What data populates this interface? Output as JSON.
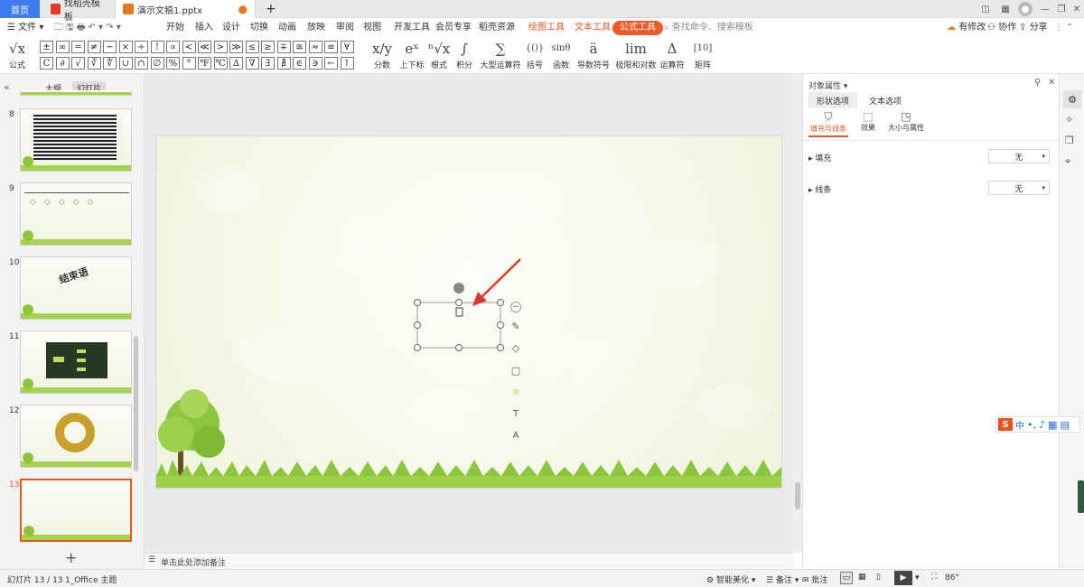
{
  "tabs": {
    "home": "首页",
    "template": "找稻壳模板",
    "document": "演示文稿1.pptx",
    "add": "+"
  },
  "menu": {
    "file": "文件",
    "items": [
      "开始",
      "插入",
      "设计",
      "切换",
      "动画",
      "放映",
      "审阅",
      "视图",
      "开发工具",
      "会员专享",
      "稻壳资源"
    ],
    "draw_tools": "绘图工具",
    "text_tools": "文本工具",
    "formula_tools": "公式工具",
    "search_placeholder": "查找命令、搜索模板",
    "pending": "有修改",
    "collab": "协作",
    "share": "分享"
  },
  "ribbon": {
    "formula_label": "公式",
    "symbols_row1": [
      "±",
      "∞",
      "=",
      "≠",
      "~",
      "×",
      "÷",
      "!",
      "∝",
      "<",
      "≪",
      ">",
      "≫",
      "≤",
      "≥",
      "∓",
      "≅",
      "≈",
      "≡",
      "∀"
    ],
    "symbols_row2": [
      "C",
      "∂",
      "√",
      "∛",
      "∜",
      "∪",
      "∩",
      "∅",
      "%",
      "°",
      "℉",
      "℃",
      "∆",
      "∇",
      "∃",
      "∄",
      "∈",
      "∋",
      "←",
      "↑"
    ],
    "groups": [
      {
        "icon": "x/y",
        "label": "分数"
      },
      {
        "icon": "eˣ",
        "label": "上下标"
      },
      {
        "icon": "ⁿ√x",
        "label": "根式"
      },
      {
        "icon": "∫",
        "label": "积分"
      },
      {
        "icon": "∑",
        "label": "大型运算符"
      },
      {
        "icon": "{()}",
        "label": "括号"
      },
      {
        "icon": "sinθ",
        "label": "函数"
      },
      {
        "icon": "ä",
        "label": "导数符号"
      },
      {
        "icon": "lim",
        "label": "极限和对数"
      },
      {
        "icon": "Δ",
        "label": "运算符"
      },
      {
        "icon": "[10]",
        "label": "矩阵"
      }
    ]
  },
  "left_panel": {
    "tab_outline": "大纲",
    "tab_slides": "幻灯片",
    "slides": [
      {
        "num": "8"
      },
      {
        "num": "9"
      },
      {
        "num": "10",
        "text": "结束语"
      },
      {
        "num": "11"
      },
      {
        "num": "12"
      },
      {
        "num": "13"
      }
    ],
    "add": "+"
  },
  "right_panel": {
    "title": "对象属性",
    "tab_shape": "形状选项",
    "tab_text": "文本选项",
    "sub_fill_line": "填充与线条",
    "sub_effect": "效果",
    "sub_size": "大小与属性",
    "fill_label": "填充",
    "fill_value": "无",
    "line_label": "线条",
    "line_value": "无"
  },
  "notes_placeholder": "单击此处添加备注",
  "status": {
    "slide_count": "幻灯片 13 / 13",
    "theme": "1_Office 主题",
    "smart": "智能美化",
    "notes": "备注",
    "comment": "批注",
    "zoom": "86"
  },
  "ime": {
    "lang": "中"
  },
  "colors": {
    "accent": "#e8541d",
    "home_tab": "#3d7df0",
    "arrow": "#d93a2b"
  }
}
